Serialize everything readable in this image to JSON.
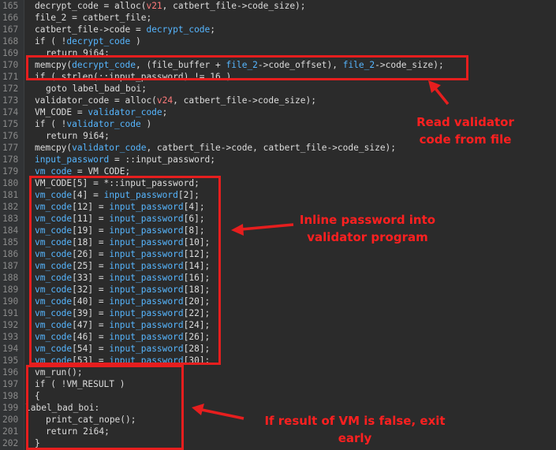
{
  "editor": {
    "lines": [
      {
        "num": "165",
        "indent": 0,
        "tokens": [
          [
            "id",
            "decrypt_code = alloc("
          ],
          [
            "num",
            "v21"
          ],
          [
            "id",
            ", catbert_file->code_size);"
          ]
        ]
      },
      {
        "num": "166",
        "indent": 0,
        "tokens": [
          [
            "id",
            "file_2 = catbert_file;"
          ]
        ]
      },
      {
        "num": "167",
        "indent": 0,
        "tokens": [
          [
            "id",
            "catbert_file->code = "
          ],
          [
            "var",
            "decrypt_code"
          ],
          [
            "id",
            ";"
          ]
        ]
      },
      {
        "num": "168",
        "indent": 0,
        "tokens": [
          [
            "id",
            "if ( !"
          ],
          [
            "var",
            "decrypt_code"
          ],
          [
            "id",
            " )"
          ]
        ]
      },
      {
        "num": "169",
        "indent": 1,
        "tokens": [
          [
            "id",
            "return 9i64;"
          ]
        ]
      },
      {
        "num": "170",
        "indent": 0,
        "tokens": [
          [
            "id",
            "memcpy("
          ],
          [
            "var",
            "decrypt_code"
          ],
          [
            "id",
            ", (file_buffer + "
          ],
          [
            "var",
            "file_2"
          ],
          [
            "id",
            "->code_offset), "
          ],
          [
            "var",
            "file_2"
          ],
          [
            "id",
            "->code_size);"
          ]
        ]
      },
      {
        "num": "171",
        "indent": 0,
        "tokens": [
          [
            "id",
            "if ( strlen(::input_password) != 16 )"
          ]
        ]
      },
      {
        "num": "172",
        "indent": 1,
        "tokens": [
          [
            "id",
            "goto label_bad_boi;"
          ]
        ]
      },
      {
        "num": "173",
        "indent": 0,
        "tokens": [
          [
            "id",
            "validator_code = alloc("
          ],
          [
            "num",
            "v24"
          ],
          [
            "id",
            ", catbert_file->code_size);"
          ]
        ]
      },
      {
        "num": "174",
        "indent": 0,
        "tokens": [
          [
            "id",
            "VM_CODE = "
          ],
          [
            "var",
            "validator_code"
          ],
          [
            "id",
            ";"
          ]
        ]
      },
      {
        "num": "175",
        "indent": 0,
        "tokens": [
          [
            "id",
            "if ( !"
          ],
          [
            "var",
            "validator_code"
          ],
          [
            "id",
            " )"
          ]
        ]
      },
      {
        "num": "176",
        "indent": 1,
        "tokens": [
          [
            "id",
            "return 9i64;"
          ]
        ]
      },
      {
        "num": "177",
        "indent": 0,
        "tokens": [
          [
            "id",
            "memcpy("
          ],
          [
            "var",
            "validator_code"
          ],
          [
            "id",
            ", catbert_file->code, catbert_file->code_size);"
          ]
        ]
      },
      {
        "num": "178",
        "indent": 0,
        "tokens": [
          [
            "var",
            "input_password"
          ],
          [
            "id",
            " = ::input_password;"
          ]
        ]
      },
      {
        "num": "179",
        "indent": 0,
        "tokens": [
          [
            "var",
            "vm_code"
          ],
          [
            "id",
            " = VM_CODE;"
          ]
        ]
      },
      {
        "num": "180",
        "indent": 0,
        "tokens": [
          [
            "id",
            "VM_CODE[5] = *::input_password;"
          ]
        ]
      },
      {
        "num": "181",
        "indent": 0,
        "tokens": [
          [
            "var",
            "vm_code"
          ],
          [
            "id",
            "[4] = "
          ],
          [
            "var",
            "input_password"
          ],
          [
            "id",
            "[2];"
          ]
        ]
      },
      {
        "num": "182",
        "indent": 0,
        "tokens": [
          [
            "var",
            "vm_code"
          ],
          [
            "id",
            "[12] = "
          ],
          [
            "var",
            "input_password"
          ],
          [
            "id",
            "[4];"
          ]
        ]
      },
      {
        "num": "183",
        "indent": 0,
        "tokens": [
          [
            "var",
            "vm_code"
          ],
          [
            "id",
            "[11] = "
          ],
          [
            "var",
            "input_password"
          ],
          [
            "id",
            "[6];"
          ]
        ]
      },
      {
        "num": "184",
        "indent": 0,
        "tokens": [
          [
            "var",
            "vm_code"
          ],
          [
            "id",
            "[19] = "
          ],
          [
            "var",
            "input_password"
          ],
          [
            "id",
            "[8];"
          ]
        ]
      },
      {
        "num": "185",
        "indent": 0,
        "tokens": [
          [
            "var",
            "vm_code"
          ],
          [
            "id",
            "[18] = "
          ],
          [
            "var",
            "input_password"
          ],
          [
            "id",
            "[10];"
          ]
        ]
      },
      {
        "num": "186",
        "indent": 0,
        "tokens": [
          [
            "var",
            "vm_code"
          ],
          [
            "id",
            "[26] = "
          ],
          [
            "var",
            "input_password"
          ],
          [
            "id",
            "[12];"
          ]
        ]
      },
      {
        "num": "187",
        "indent": 0,
        "tokens": [
          [
            "var",
            "vm_code"
          ],
          [
            "id",
            "[25] = "
          ],
          [
            "var",
            "input_password"
          ],
          [
            "id",
            "[14];"
          ]
        ]
      },
      {
        "num": "188",
        "indent": 0,
        "tokens": [
          [
            "var",
            "vm_code"
          ],
          [
            "id",
            "[33] = "
          ],
          [
            "var",
            "input_password"
          ],
          [
            "id",
            "[16];"
          ]
        ]
      },
      {
        "num": "189",
        "indent": 0,
        "tokens": [
          [
            "var",
            "vm_code"
          ],
          [
            "id",
            "[32] = "
          ],
          [
            "var",
            "input_password"
          ],
          [
            "id",
            "[18];"
          ]
        ]
      },
      {
        "num": "190",
        "indent": 0,
        "tokens": [
          [
            "var",
            "vm_code"
          ],
          [
            "id",
            "[40] = "
          ],
          [
            "var",
            "input_password"
          ],
          [
            "id",
            "[20];"
          ]
        ]
      },
      {
        "num": "191",
        "indent": 0,
        "tokens": [
          [
            "var",
            "vm_code"
          ],
          [
            "id",
            "[39] = "
          ],
          [
            "var",
            "input_password"
          ],
          [
            "id",
            "[22];"
          ]
        ]
      },
      {
        "num": "192",
        "indent": 0,
        "tokens": [
          [
            "var",
            "vm_code"
          ],
          [
            "id",
            "[47] = "
          ],
          [
            "var",
            "input_password"
          ],
          [
            "id",
            "[24];"
          ]
        ]
      },
      {
        "num": "193",
        "indent": 0,
        "tokens": [
          [
            "var",
            "vm_code"
          ],
          [
            "id",
            "[46] = "
          ],
          [
            "var",
            "input_password"
          ],
          [
            "id",
            "[26];"
          ]
        ]
      },
      {
        "num": "194",
        "indent": 0,
        "tokens": [
          [
            "var",
            "vm_code"
          ],
          [
            "id",
            "[54] = "
          ],
          [
            "var",
            "input_password"
          ],
          [
            "id",
            "[28];"
          ]
        ]
      },
      {
        "num": "195",
        "indent": 0,
        "tokens": [
          [
            "var",
            "vm_code"
          ],
          [
            "id",
            "[53] = "
          ],
          [
            "var",
            "input_password"
          ],
          [
            "id",
            "[30];"
          ]
        ]
      },
      {
        "num": "196",
        "indent": 0,
        "tokens": [
          [
            "id",
            "vm_run();"
          ]
        ]
      },
      {
        "num": "197",
        "indent": 0,
        "tokens": [
          [
            "id",
            "if ( !VM_RESULT )"
          ]
        ]
      },
      {
        "num": "198",
        "indent": 0,
        "tokens": [
          [
            "id",
            "{"
          ]
        ]
      },
      {
        "num": "199",
        "indent": -1,
        "tokens": [
          [
            "id",
            "label_bad_boi:"
          ]
        ]
      },
      {
        "num": "200",
        "indent": 1,
        "tokens": [
          [
            "id",
            "print_cat_nope();"
          ]
        ]
      },
      {
        "num": "201",
        "indent": 1,
        "tokens": [
          [
            "id",
            "return 2i64;"
          ]
        ]
      },
      {
        "num": "202",
        "indent": 0,
        "tokens": [
          [
            "id",
            "}"
          ]
        ]
      }
    ]
  },
  "annotations": {
    "read_validator": "Read validator code from file",
    "inline_password": "Inline password into validator program",
    "vm_false": "If result of VM is false, exit early"
  },
  "colors": {
    "annotation": "#e61e1e",
    "variable": "#56b6ff",
    "number": "#ff7a7a",
    "text": "#dcdcdc",
    "background": "#2b2b2b"
  }
}
